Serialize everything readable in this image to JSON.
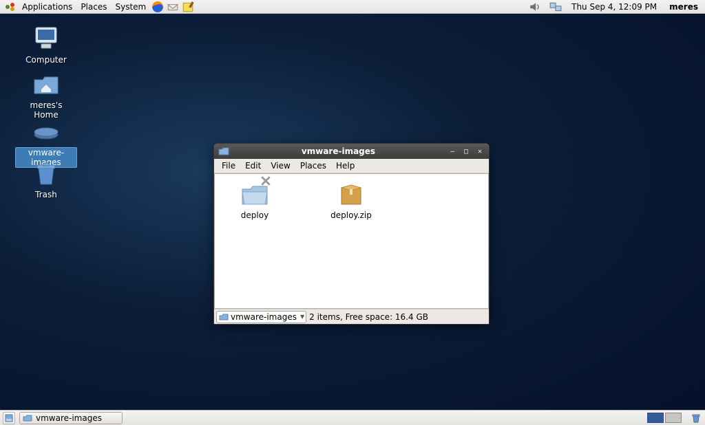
{
  "top_panel": {
    "menus": {
      "applications": "Applications",
      "places": "Places",
      "system": "System"
    },
    "clock": "Thu Sep  4, 12:09 PM",
    "user": "meres"
  },
  "desktop_icons": {
    "computer": {
      "label": "Computer"
    },
    "home": {
      "label": "meres's Home"
    },
    "vmware": {
      "label": "vmware-images"
    },
    "trash": {
      "label": "Trash"
    }
  },
  "window": {
    "title": "vmware-images",
    "menubar": {
      "file": "File",
      "edit": "Edit",
      "view": "View",
      "places": "Places",
      "help": "Help"
    },
    "contents": {
      "items": [
        {
          "name": "deploy",
          "type": "folder-ro"
        },
        {
          "name": "deploy.zip",
          "type": "archive"
        }
      ]
    },
    "path_selector": "vmware-images",
    "status": "2 items, Free space: 16.4 GB"
  },
  "bottom_panel": {
    "task": "vmware-images"
  }
}
